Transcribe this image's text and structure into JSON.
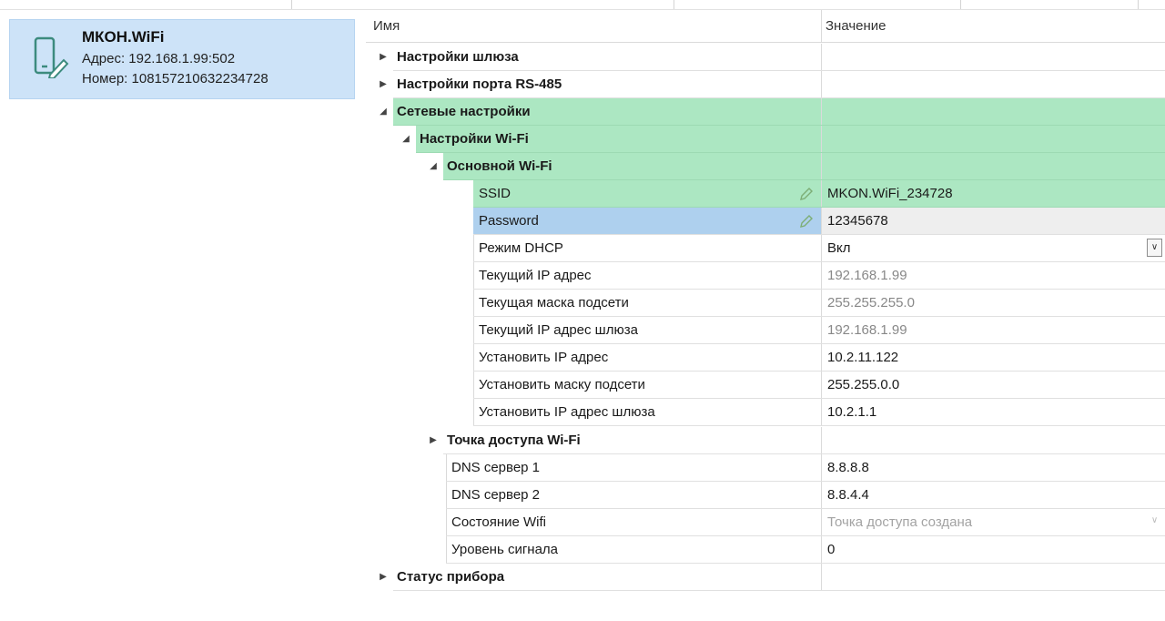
{
  "device": {
    "title": "МКОН.WiFi",
    "address": "Адрес: 192.168.1.99:502",
    "number": "Номер: 108157210632234728",
    "icon": "device-edit-icon"
  },
  "grid": {
    "header_name": "Имя",
    "header_value": "Значение",
    "rows": [
      {
        "name": "Настройки шлюза",
        "value": "",
        "expander": "▶"
      },
      {
        "name": "Настройки порта RS-485",
        "value": "",
        "expander": "▶"
      },
      {
        "name": "Сетевые настройки",
        "value": "",
        "expander": "◢"
      },
      {
        "name": "Настройки Wi-Fi",
        "value": "",
        "expander": "◢"
      },
      {
        "name": "Основной Wi-Fi",
        "value": "",
        "expander": "◢"
      },
      {
        "name": "SSID",
        "value": "MKON.WiFi_234728",
        "icon": "pencil-icon"
      },
      {
        "name": "Password",
        "value": "12345678",
        "icon": "pencil-icon"
      },
      {
        "name": "Режим DHCP",
        "value": "Вкл",
        "dropdown": "chevron-down-icon"
      },
      {
        "name": "Текущий IP адрес",
        "value": "192.168.1.99"
      },
      {
        "name": "Текущая маска подсети",
        "value": "255.255.255.0"
      },
      {
        "name": "Текущий IP адрес шлюза",
        "value": "192.168.1.99"
      },
      {
        "name": "Установить IP адрес",
        "value": "10.2.11.122"
      },
      {
        "name": "Установить маску подсети",
        "value": "255.255.0.0"
      },
      {
        "name": "Установить IP адрес шлюза",
        "value": "10.2.1.1"
      },
      {
        "name": "Точка доступа Wi-Fi",
        "value": "",
        "expander": "▶"
      },
      {
        "name": "DNS сервер 1",
        "value": "8.8.8.8"
      },
      {
        "name": "DNS сервер 2",
        "value": "8.8.4.4"
      },
      {
        "name": "Состояние Wifi",
        "value": "Точка доступа создана",
        "dropdown": "chevron-down-icon"
      },
      {
        "name": "Уровень сигнала",
        "value": "0"
      },
      {
        "name": "Статус прибора",
        "value": "",
        "expander": "▶"
      }
    ]
  },
  "colors": {
    "selected_device": "#cde3f8",
    "group_highlight": "#ace7c2",
    "selected_row": "#aed0ee"
  }
}
